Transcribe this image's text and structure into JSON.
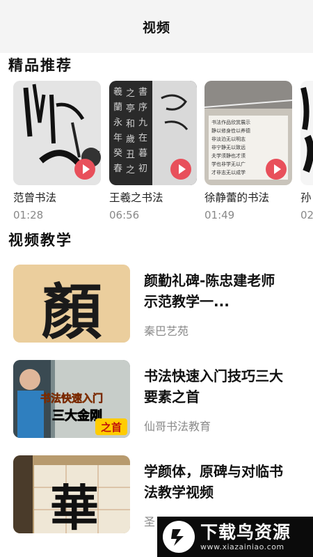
{
  "header": {
    "title": "视频"
  },
  "sections": {
    "featured": "精品推荐",
    "teaching": "视频教学"
  },
  "featured": [
    {
      "title": "范曾书法",
      "duration": "01:28"
    },
    {
      "title": "王羲之书法",
      "duration": "06:56"
    },
    {
      "title": "徐静蕾的书法",
      "duration": "01:49"
    },
    {
      "title": "孙",
      "duration": "02"
    }
  ],
  "teaching": [
    {
      "title": "颜勤礼碑-陈忠建老师示范教学一...",
      "author": "秦巴艺苑",
      "thumb_text": "顏"
    },
    {
      "title": "书法快速入门技巧三大要素之首",
      "author": "仙哥书法教育",
      "thumb_text_1": "书法快速入门",
      "thumb_text_2": "三大金刚",
      "thumb_badge": "之首"
    },
    {
      "title": "学颜体，原碑与对临书法教学视频",
      "author": "圣",
      "thumb_text": "華"
    }
  ],
  "watermark": {
    "text": "下载鸟资源",
    "url": "www.xiazainiao.com"
  },
  "colors": {
    "play": "#e8505b",
    "muted": "#888888"
  }
}
